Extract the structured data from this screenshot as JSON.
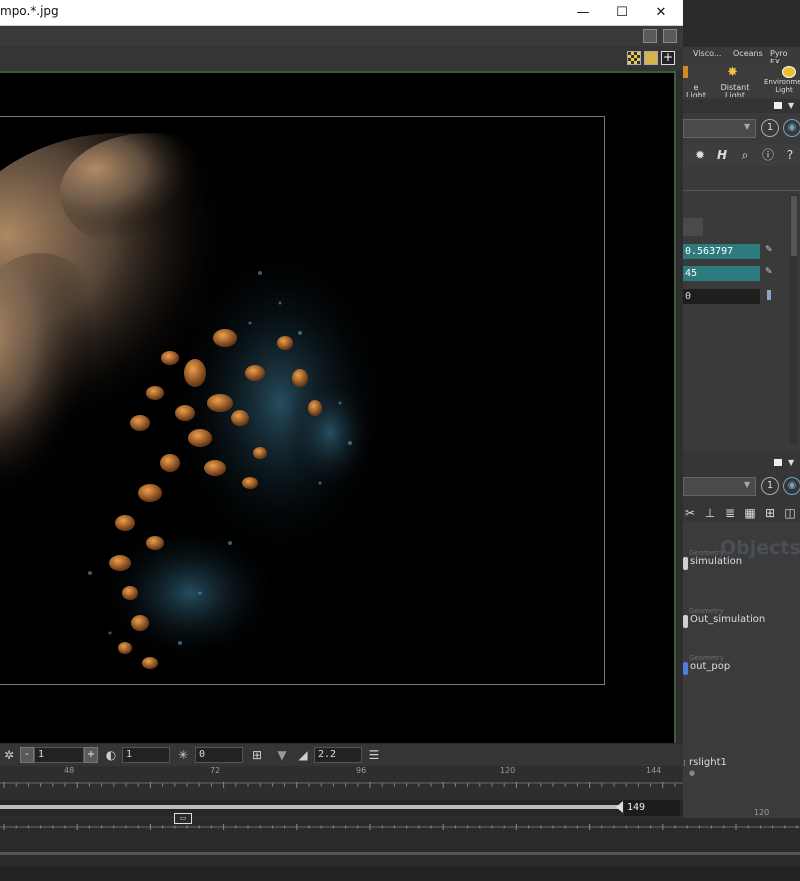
{
  "viewer": {
    "title": "mpo.*.jpg",
    "window_buttons": {
      "minimize": "—",
      "maximize": "☐",
      "close": "✕"
    },
    "controls": {
      "minus_label": "-",
      "field1_value": "1",
      "plus_label": "+",
      "field2_value": "1",
      "field3_value": "0",
      "field4_value": "2.2"
    },
    "ruler_ticks": [
      "48",
      "72",
      "96",
      "120",
      "144"
    ],
    "frame_value": "149"
  },
  "houdini": {
    "shelf_tabs": [
      "Visco...",
      "Oceans",
      "Pyro FX"
    ],
    "shelf_tools": [
      {
        "label": "e Light",
        "icon": "spot-light-icon"
      },
      {
        "label": "Distant Light",
        "icon": "distant-light-icon"
      },
      {
        "label": "Environment Light",
        "icon": "environment-light-icon"
      }
    ],
    "params": {
      "value1": "0.563797",
      "value2": "45",
      "value3": "0"
    },
    "network": {
      "watermark": "Objects",
      "nodes": [
        {
          "type": "Geometry",
          "name": "simulation",
          "color": "#cfcfcf"
        },
        {
          "type": "Geometry",
          "name": "Out_simulation",
          "color": "#cfcfcf"
        },
        {
          "type": "Geometry",
          "name": "out_pop",
          "color": "#4f7fd8"
        },
        {
          "type": "",
          "name": "rslight1",
          "color": ""
        }
      ]
    },
    "timeline_tick": "120"
  }
}
